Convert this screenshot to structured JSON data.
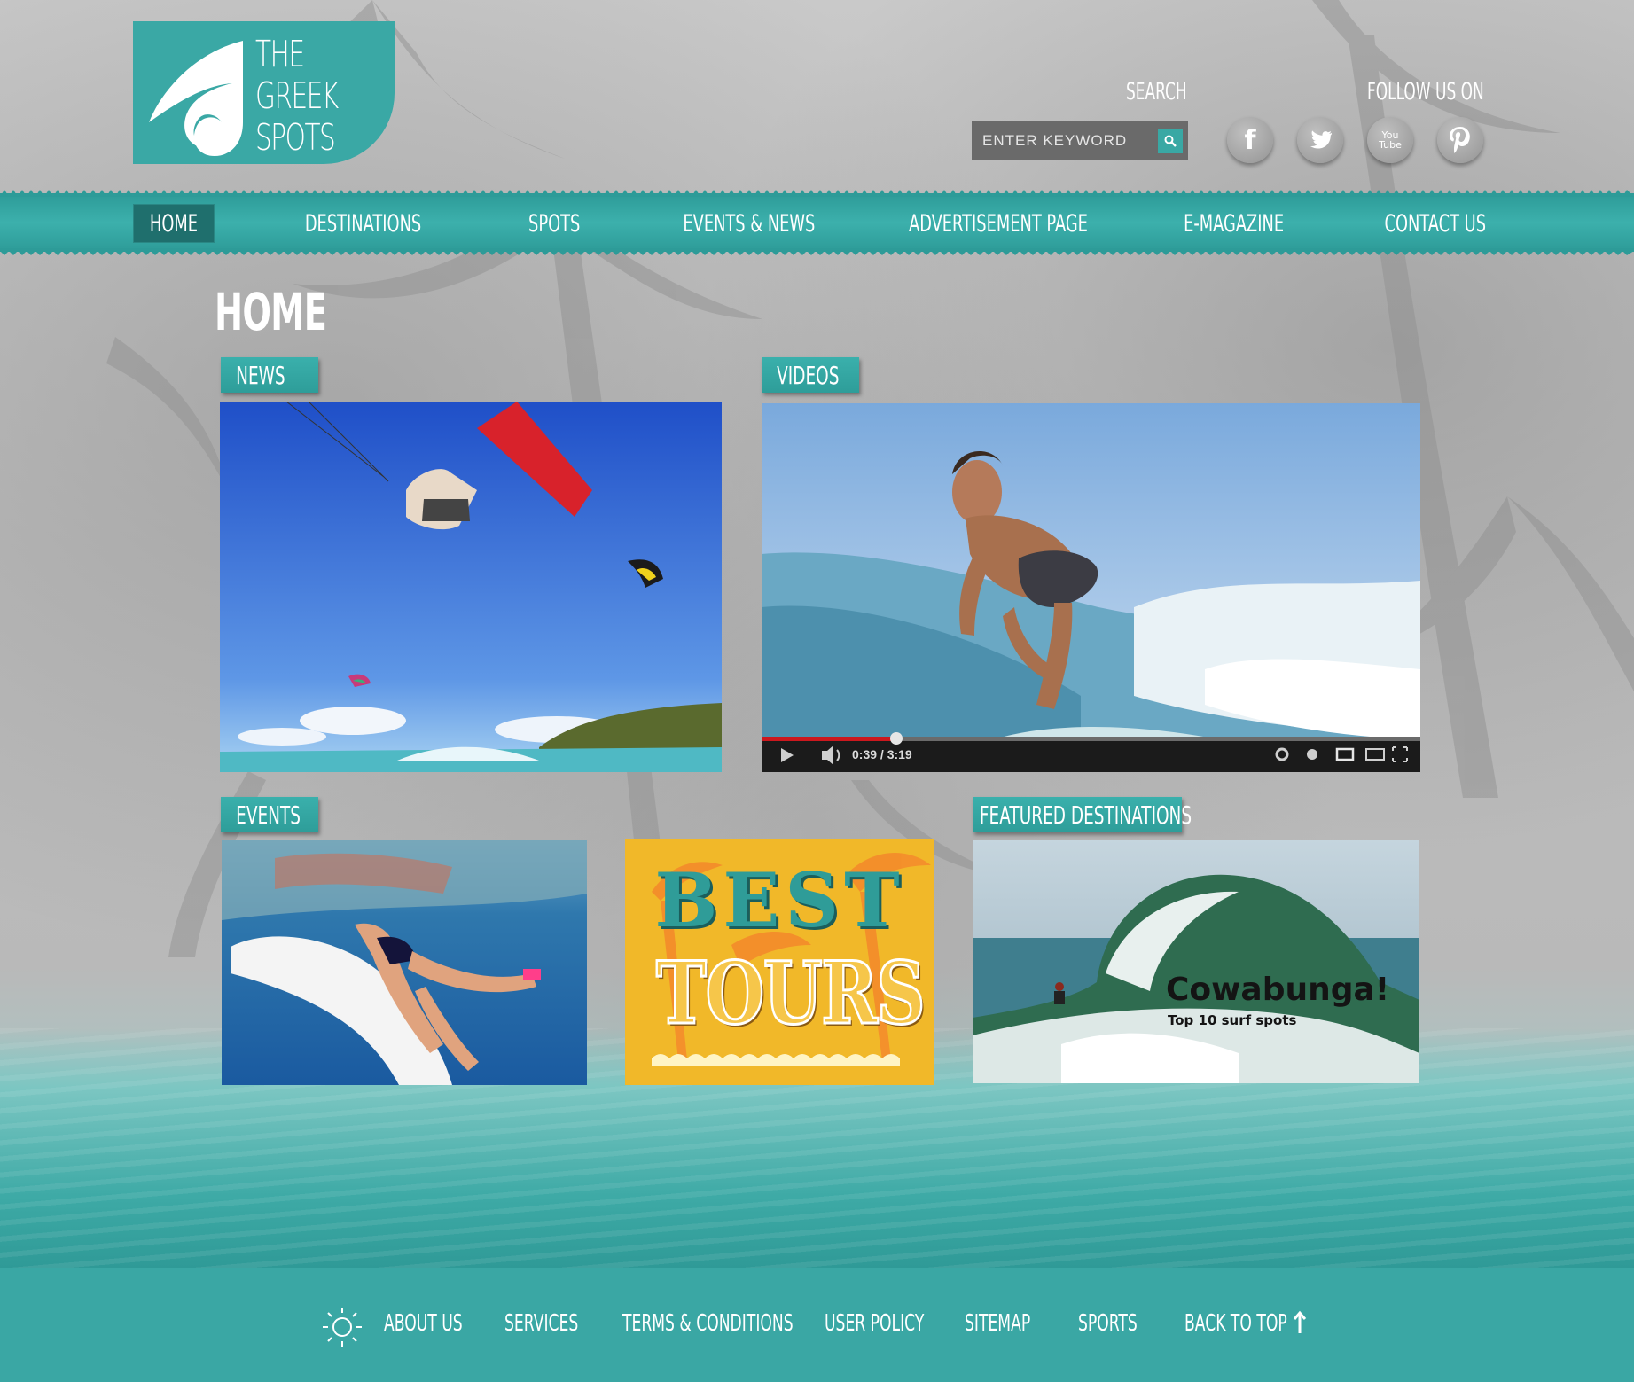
{
  "brand": {
    "line1": "THE",
    "line2": "GREEK",
    "line3": "SPOTS",
    "color": "#3aa8a5"
  },
  "header": {
    "search_label": "SEARCH",
    "search_placeholder": "ENTER KEYWORD",
    "follow_label": "FOLLOW US ON",
    "social": [
      {
        "name": "facebook-icon",
        "glyph": "f"
      },
      {
        "name": "twitter-icon",
        "glyph": ""
      },
      {
        "name": "youtube-icon",
        "glyph": "You Tube"
      },
      {
        "name": "pinterest-icon",
        "glyph": "P"
      }
    ]
  },
  "nav": {
    "items": [
      {
        "label": "HOME",
        "active": true
      },
      {
        "label": "DESTINATIONS"
      },
      {
        "label": "SPOTS"
      },
      {
        "label": "EVENTS & NEWS"
      },
      {
        "label": "ADVERTISEMENT PAGE"
      },
      {
        "label": "E-MAGAZINE"
      },
      {
        "label": "CONTACT US"
      }
    ]
  },
  "main": {
    "title": "HOME",
    "sections": {
      "news": "NEWS",
      "videos": "VIDEOS",
      "events": "EVENTS",
      "featured": "FEATURED DESTINATIONS"
    },
    "video": {
      "time": "0:39 / 3:19",
      "progress": 0.2
    },
    "ad": {
      "line1": "BEST",
      "line2": "TOURS"
    },
    "featured_card": {
      "title": "Cowabunga!",
      "subtitle": "Top 10 surf spots"
    }
  },
  "footer": {
    "items": [
      "ABOUT US",
      "SERVICES",
      "TERMS & CONDITIONS",
      "USER POLICY",
      "SITEMAP",
      "SPORTS",
      "BACK TO TOP"
    ]
  },
  "colors": {
    "teal": "#3aa7a4",
    "dark_teal": "#1f6f6d",
    "video_red": "#cc181e"
  }
}
